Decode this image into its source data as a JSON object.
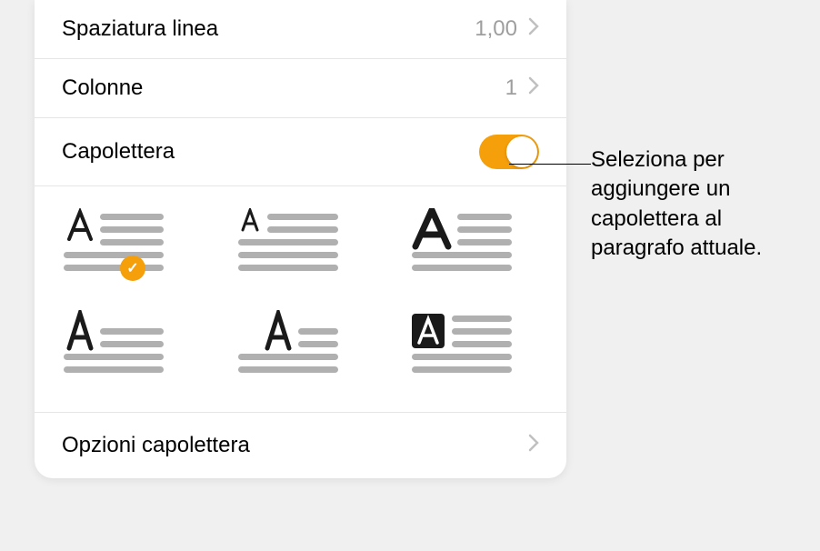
{
  "rows": {
    "line_spacing": {
      "label": "Spaziatura linea",
      "value": "1,00"
    },
    "columns": {
      "label": "Colonne",
      "value": "1"
    },
    "dropcap": {
      "label": "Capolettera"
    }
  },
  "dropcap_options_label": "Opzioni capolettera",
  "callout_text": "Seleziona per aggiungere un capolettera al paragrafo attuale.",
  "colors": {
    "accent": "#f59f0a"
  },
  "dropcap_styles": [
    {
      "id": "style-1",
      "selected": true
    },
    {
      "id": "style-2",
      "selected": false
    },
    {
      "id": "style-3",
      "selected": false
    },
    {
      "id": "style-4",
      "selected": false
    },
    {
      "id": "style-5",
      "selected": false
    },
    {
      "id": "style-6",
      "selected": false
    }
  ]
}
